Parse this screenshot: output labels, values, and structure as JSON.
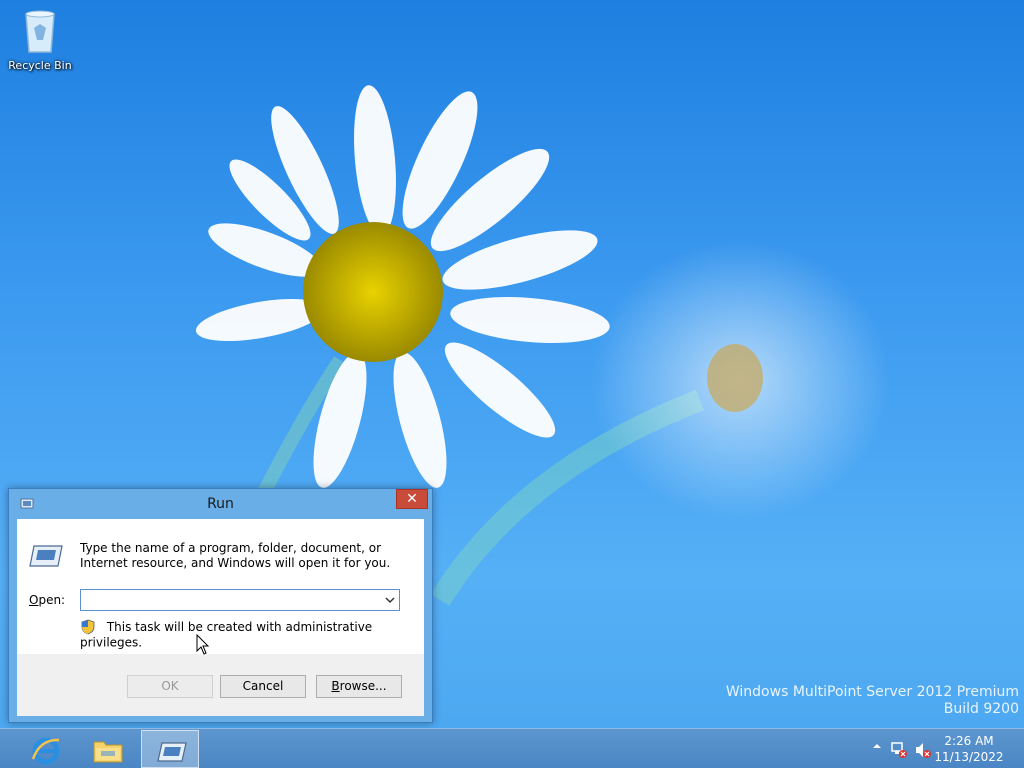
{
  "desktop": {
    "icons": [
      {
        "label": "Recycle Bin",
        "icon": "recycle-bin-icon"
      }
    ],
    "watermark": {
      "line1": "Windows MultiPoint Server 2012 Premium",
      "line2": "Build 9200"
    }
  },
  "run_dialog": {
    "title": "Run",
    "close_label": "✕",
    "description": "Type the name of a program, folder, document, or Internet resource, and Windows will open it for you.",
    "open_label_accel": "O",
    "open_label_rest": "pen:",
    "open_value": "",
    "admin_note": "This task will be created with administrative privileges.",
    "buttons": {
      "ok": "OK",
      "cancel": "Cancel",
      "browse_accel": "B",
      "browse_rest": "rowse..."
    }
  },
  "taskbar": {
    "pinned": [
      {
        "name": "internet-explorer",
        "icon": "internet-explorer-icon"
      },
      {
        "name": "file-explorer",
        "icon": "folder-icon"
      },
      {
        "name": "run",
        "icon": "run-icon",
        "active": true
      }
    ],
    "clock": {
      "time": "2:26 AM",
      "date": "11/13/2022"
    }
  },
  "colors": {
    "taskbar": "#4a86c4",
    "desktop": "#3d9bf0",
    "close": "#c94b3a"
  }
}
